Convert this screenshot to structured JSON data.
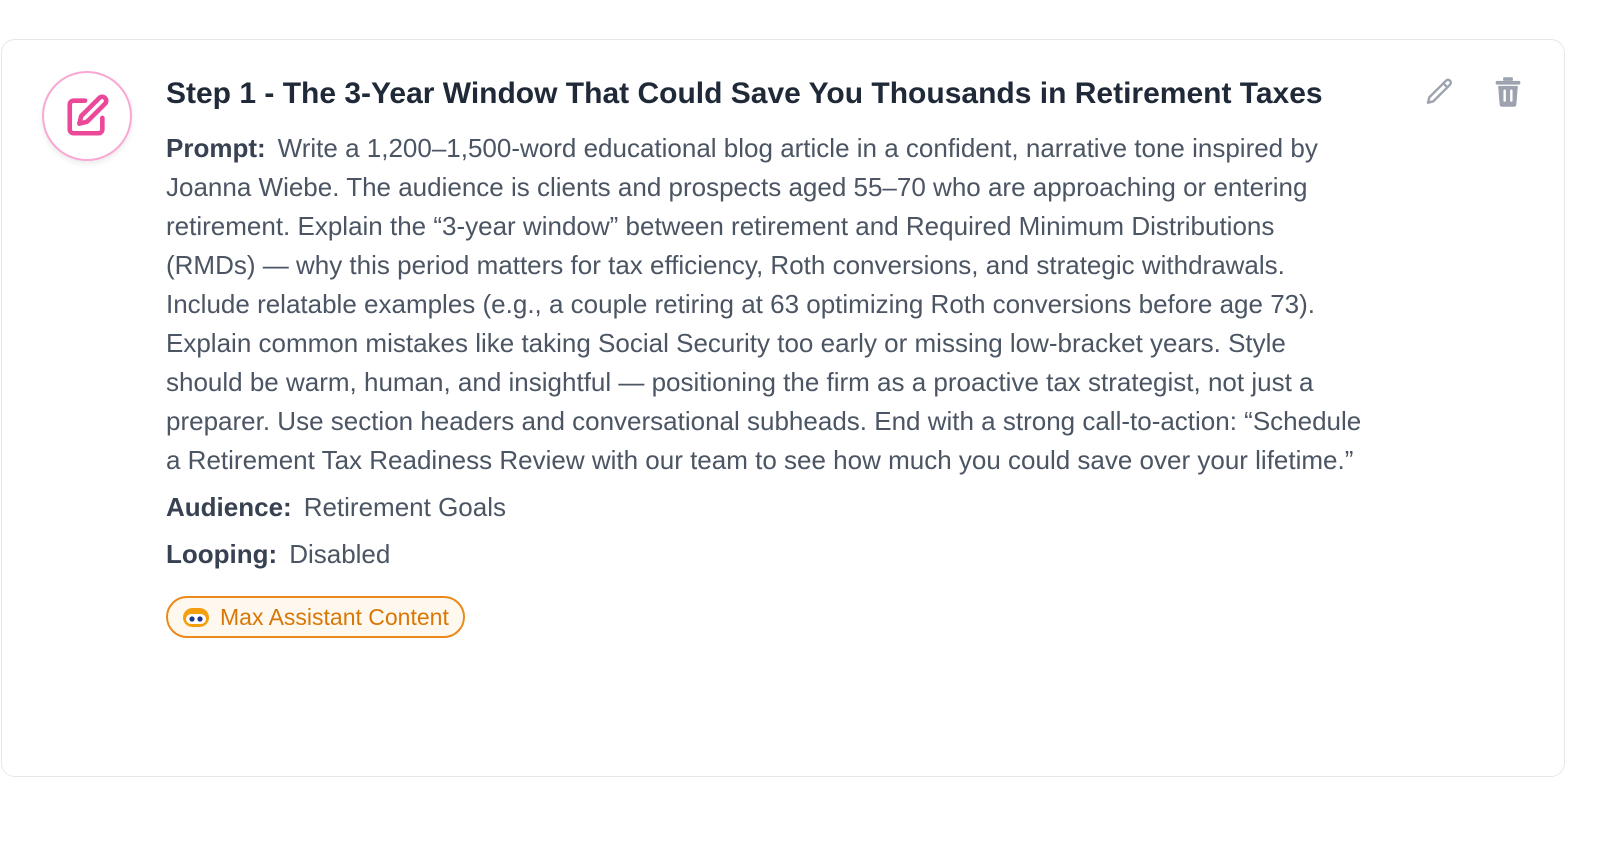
{
  "step": {
    "title": "Step 1 - The 3-Year Window That Could Save You Thousands in Retirement Taxes",
    "icon": "edit-note-icon",
    "accent_color": "#ec4899",
    "prompt_label": "Prompt:",
    "prompt_text": "Write a 1,200–1,500-word educational blog article in a confident, narrative tone inspired by Joanna Wiebe. The audience is clients and prospects aged 55–70 who are approaching or entering retirement. Explain the “3-year window” between retirement and Required Minimum Distributions (RMDs) — why this period matters for tax efficiency, Roth conversions, and strategic withdrawals. Include relatable examples (e.g., a couple retiring at 63 optimizing Roth conversions before age 73). Explain common mistakes like taking Social Security too early or missing low-bracket years. Style should be warm, human, and insightful — positioning the firm as a proactive tax strategist, not just a preparer. Use section headers and conversational subheads. End with a strong call-to-action: “Schedule a Retirement Tax Readiness Review with our team to see how much you could save over your lifetime.”",
    "audience_label": "Audience:",
    "audience_value": "Retirement Goals",
    "looping_label": "Looping:",
    "looping_value": "Disabled",
    "badge_label": "Max Assistant Content",
    "badge_icon": "robot-icon",
    "badge_color": "#d97706",
    "actions": {
      "edit_icon": "pencil-icon",
      "delete_icon": "trash-icon"
    }
  }
}
